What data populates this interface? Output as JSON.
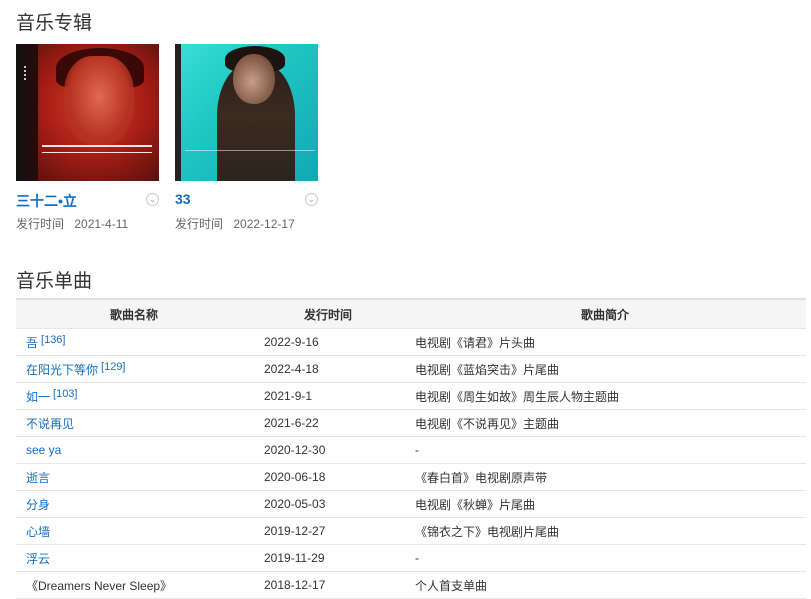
{
  "albums_section": {
    "title": "音乐专辑",
    "albums": [
      {
        "name": "三十二•立",
        "date_label": "发行时间",
        "date": "2021-4-11"
      },
      {
        "name": "33",
        "date_label": "发行时间",
        "date": "2022-12-17"
      }
    ]
  },
  "singles_section": {
    "title": "音乐单曲",
    "columns": [
      "歌曲名称",
      "发行时间",
      "歌曲简介"
    ],
    "rows": [
      {
        "name": "吾",
        "ref": "[136]",
        "date": "2022-9-16",
        "desc": "电视剧《请君》片头曲",
        "link": true
      },
      {
        "name": "在阳光下等你",
        "ref": "[129]",
        "date": "2022-4-18",
        "desc": "电视剧《蓝焰突击》片尾曲",
        "link": true
      },
      {
        "name": "如一",
        "ref": "[103]",
        "date": "2021-9-1",
        "desc": "电视剧《周生如故》周生辰人物主题曲",
        "link": true
      },
      {
        "name": "不说再见",
        "ref": "",
        "date": "2021-6-22",
        "desc": "电视剧《不说再见》主题曲",
        "link": true
      },
      {
        "name": "see ya",
        "ref": "",
        "date": "2020-12-30",
        "desc": "-",
        "link": true
      },
      {
        "name": "逝言",
        "ref": "",
        "date": "2020-06-18",
        "desc": "《春白首》电视剧原声带",
        "link": true
      },
      {
        "name": "分身",
        "ref": "",
        "date": "2020-05-03",
        "desc": "电视剧《秋蝉》片尾曲",
        "link": true
      },
      {
        "name": "心墙",
        "ref": "",
        "date": "2019-12-27",
        "desc": "《锦衣之下》电视剧片尾曲",
        "link": true
      },
      {
        "name": "浮云",
        "ref": "",
        "date": "2019-11-29",
        "desc": "-",
        "link": true
      },
      {
        "name": "《Dreamers Never Sleep》",
        "ref": "",
        "date": "2018-12-17",
        "desc": "个人首支单曲",
        "link": false
      }
    ]
  },
  "colors": {
    "link": "#136ec2",
    "text": "#333333",
    "muted": "#666666"
  },
  "icons": {
    "album_expand": "chevron-down-icon"
  }
}
